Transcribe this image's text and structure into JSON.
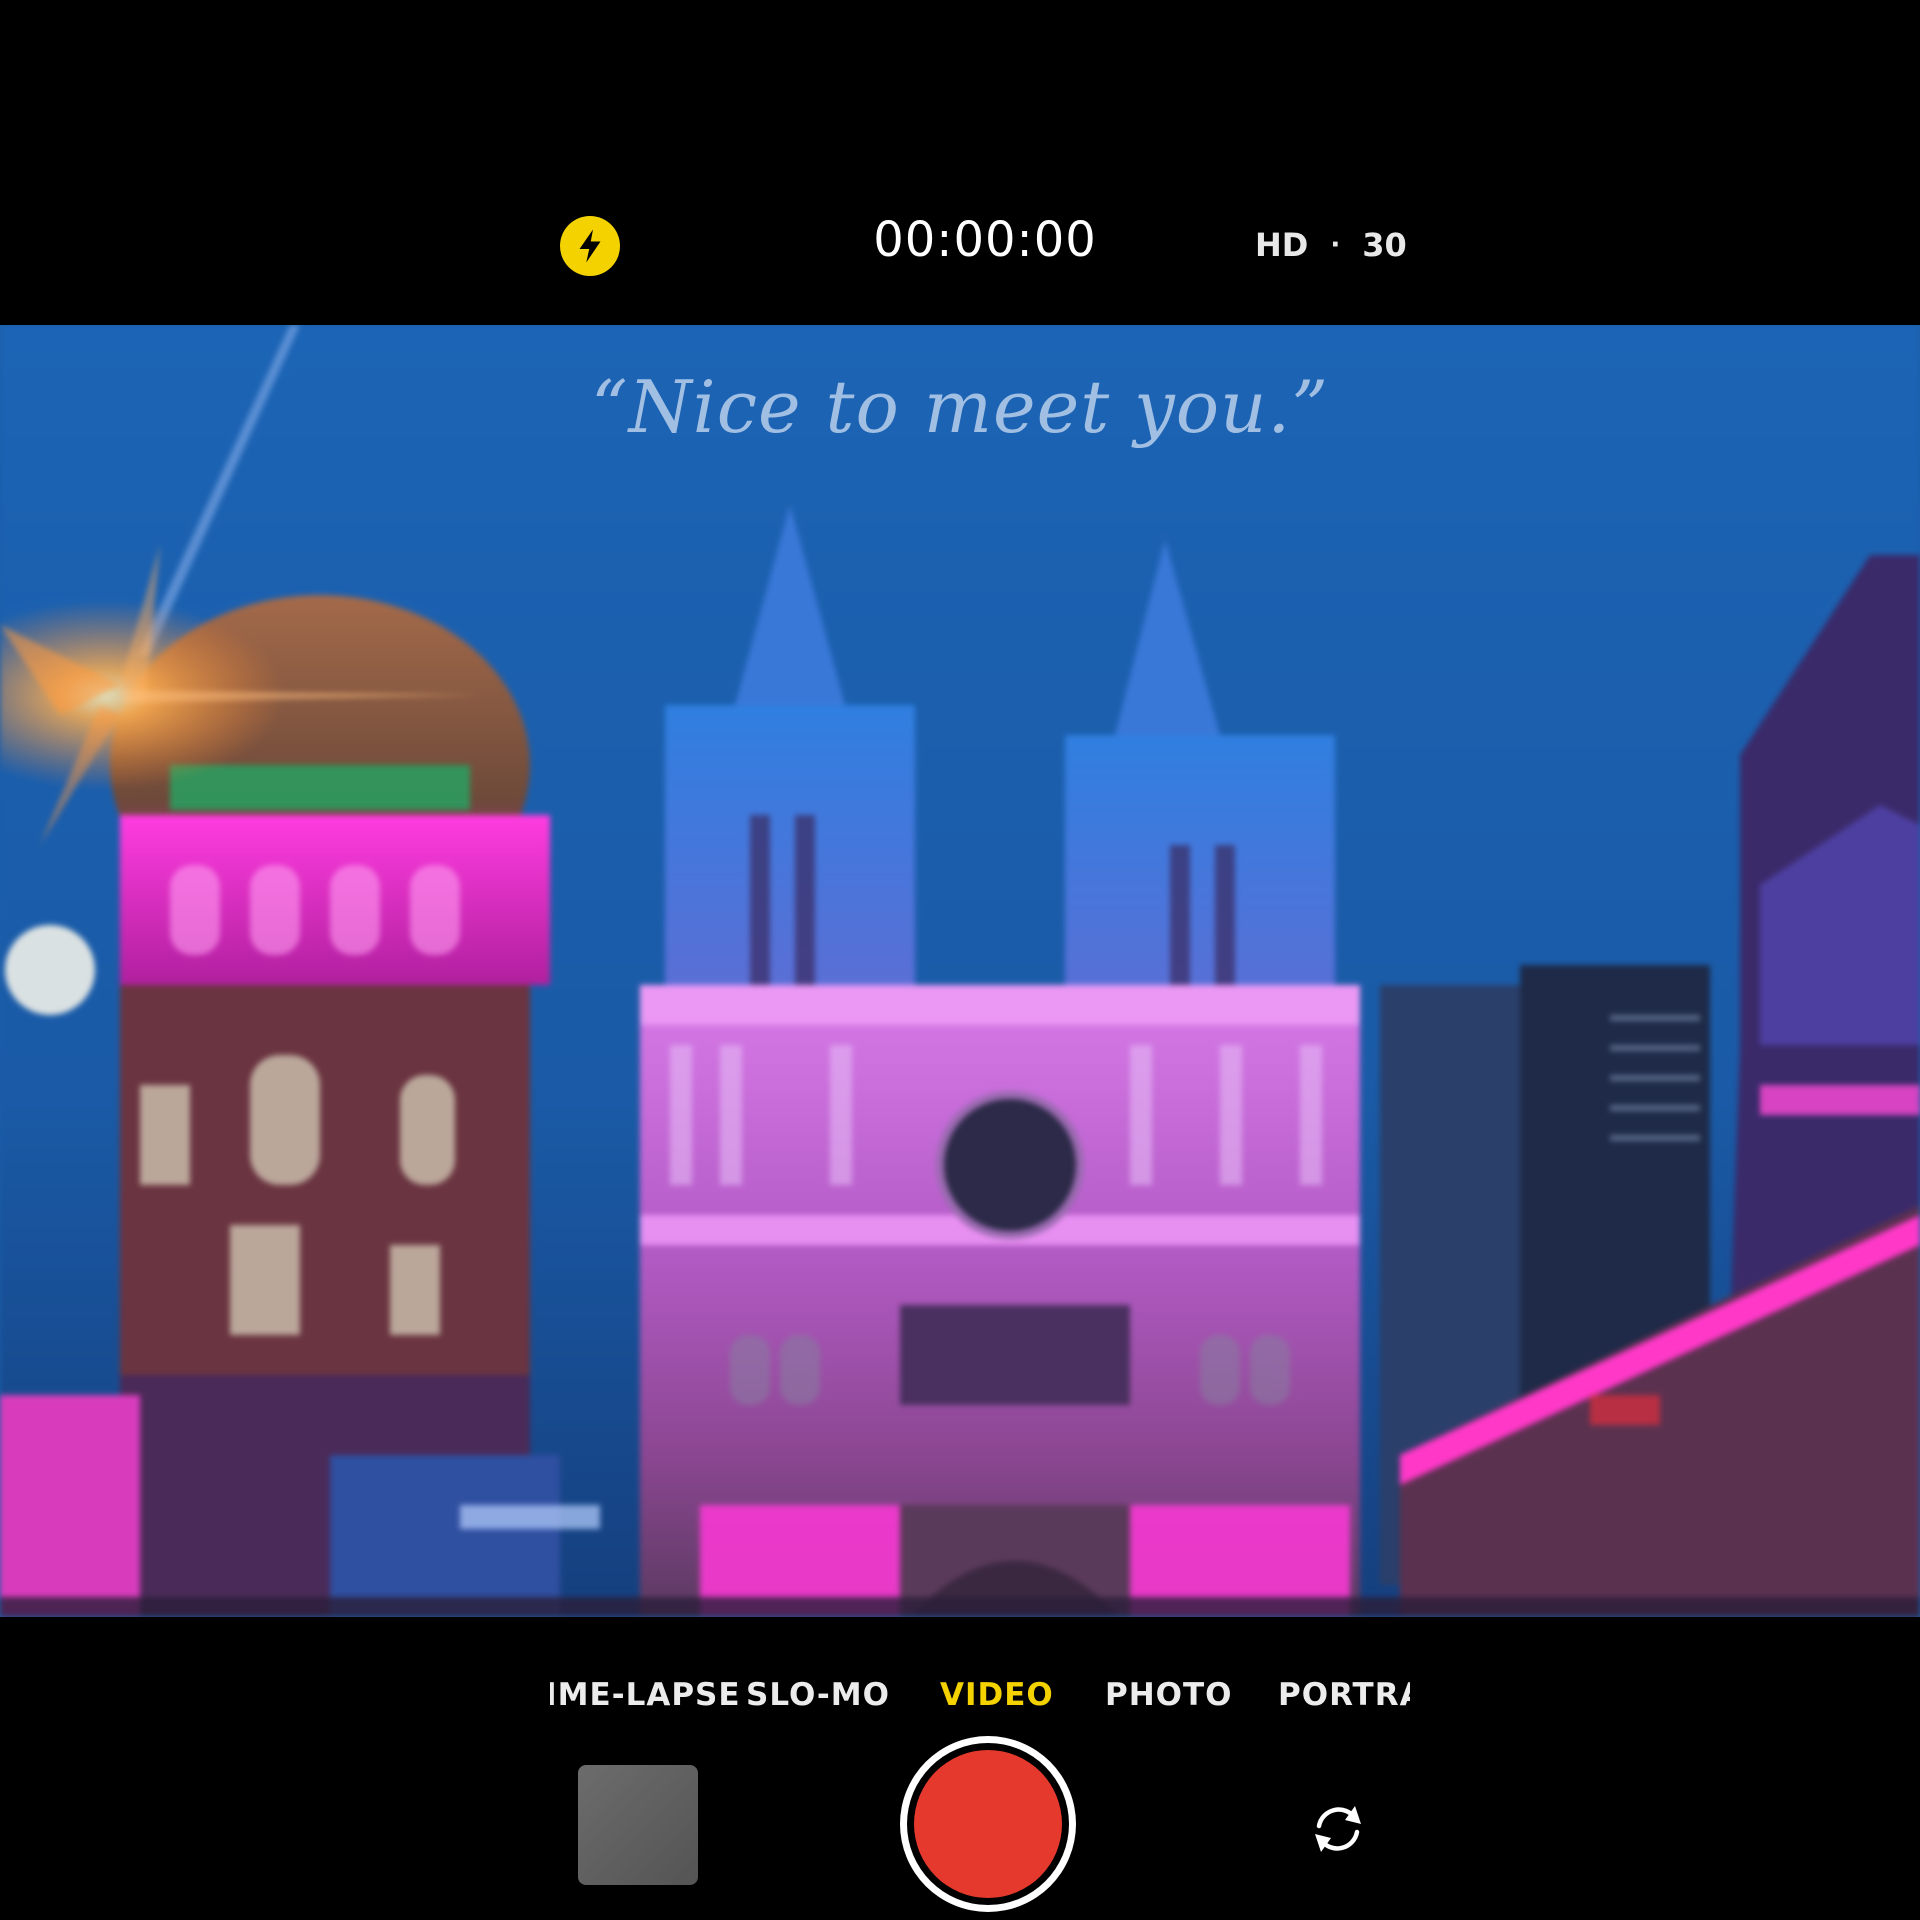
{
  "top_bar": {
    "flash_icon": "lightning-bolt-icon",
    "timer": "00:00:00",
    "resolution": "HD",
    "separator": "·",
    "frame_rate": "30"
  },
  "viewfinder": {
    "caption": "“Nice to meet you.”"
  },
  "modes": [
    {
      "label": "TIME-LAPSE",
      "active": false
    },
    {
      "label": "SLO-MO",
      "active": false
    },
    {
      "label": "VIDEO",
      "active": true
    },
    {
      "label": "PHOTO",
      "active": false
    },
    {
      "label": "PORTRAIT",
      "active": false
    }
  ],
  "controls": {
    "shutter_color": "#e4392c",
    "accent_color": "#f4d200",
    "flip_icon": "camera-flip-icon"
  }
}
